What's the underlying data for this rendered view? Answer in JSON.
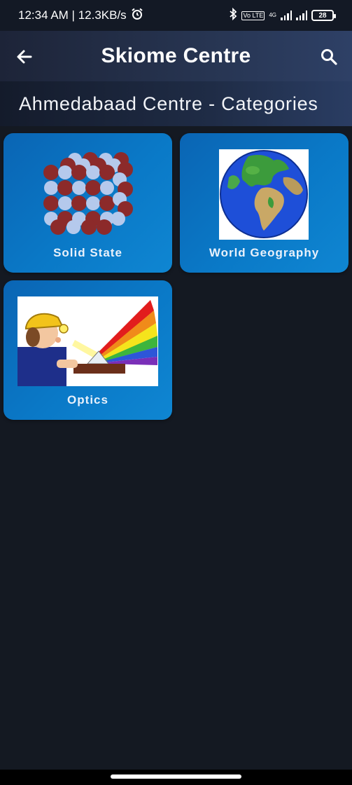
{
  "status_bar": {
    "time_speed": "12:34 AM | 12.3KB/s",
    "network": "4G",
    "volte": "Vo LTE",
    "battery": "28"
  },
  "app_bar": {
    "title": "Skiome Centre",
    "back_icon": "arrow-left-icon",
    "search_icon": "search-icon"
  },
  "subheader": {
    "title": "Ahmedabaad Centre - Categories"
  },
  "categories": [
    {
      "label": "Solid State",
      "icon": "crystal-lattice-image"
    },
    {
      "label": "World Geography",
      "icon": "globe-image"
    },
    {
      "label": "Optics",
      "icon": "prism-optics-image"
    }
  ],
  "colors": {
    "background": "#141922",
    "card": "#0a79c7",
    "app_bar": "#273552"
  }
}
